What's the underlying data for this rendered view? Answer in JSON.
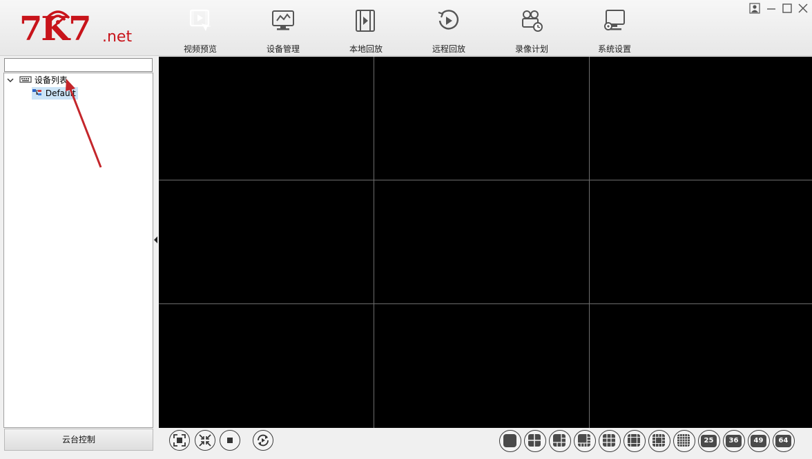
{
  "logo": {
    "big": "7K7",
    "net": ".net"
  },
  "nav": [
    {
      "label": "视频预览",
      "icon": "video-preview-icon",
      "active": true
    },
    {
      "label": "设备管理",
      "icon": "device-manage-icon",
      "active": false
    },
    {
      "label": "本地回放",
      "icon": "local-playback-icon",
      "active": false
    },
    {
      "label": "远程回放",
      "icon": "remote-playback-icon",
      "active": false
    },
    {
      "label": "录像计划",
      "icon": "record-plan-icon",
      "active": false
    },
    {
      "label": "系统设置",
      "icon": "system-settings-icon",
      "active": false
    }
  ],
  "window_controls": [
    "user-icon",
    "minimize-icon",
    "maximize-icon",
    "close-icon"
  ],
  "search": {
    "value": "",
    "placeholder": ""
  },
  "tree": {
    "root_label": "设备列表",
    "children": [
      {
        "label": "Default",
        "selected": true
      }
    ]
  },
  "ptz_label": "云台控制",
  "grid": {
    "rows": 3,
    "cols": 3
  },
  "controls_left": [
    "fullscreen-icon",
    "fit-icon",
    "stop-all-icon",
    "cycle-icon"
  ],
  "layouts": [
    {
      "kind": "single"
    },
    {
      "kind": "quad"
    },
    {
      "kind": "six"
    },
    {
      "kind": "eight"
    },
    {
      "kind": "nine"
    },
    {
      "kind": "thirteen"
    },
    {
      "kind": "sixteen"
    },
    {
      "kind": "twenty"
    },
    {
      "kind": "number",
      "text": "25"
    },
    {
      "kind": "number",
      "text": "36"
    },
    {
      "kind": "number",
      "text": "49"
    },
    {
      "kind": "number",
      "text": "64"
    }
  ],
  "colors": {
    "accent": "#16b132",
    "brand": "#c8141b",
    "arrow": "#c4262b"
  }
}
